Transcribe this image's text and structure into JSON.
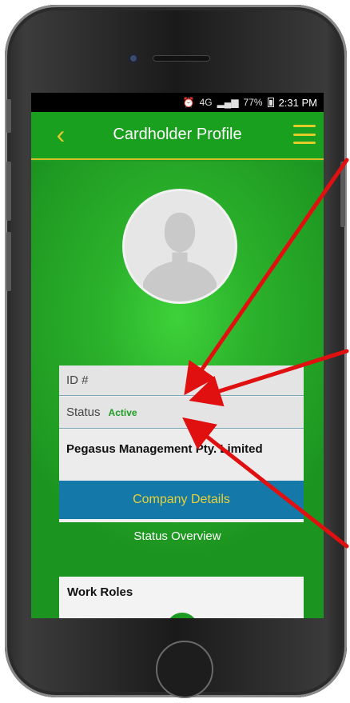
{
  "status_bar": {
    "network": "4G",
    "battery": "77%",
    "time": "2:31 PM"
  },
  "app_bar": {
    "back_icon": "chevron-left-icon",
    "title": "Cardholder Profile",
    "menu_icon": "hamburger-menu-icon"
  },
  "profile": {
    "avatar_icon": "person-silhouette-icon"
  },
  "details": {
    "id_label": "ID #",
    "status_label": "Status",
    "status_value": "Active",
    "company_name": "Pegasus Management Pty. Limited",
    "company_button_label": "Company Details"
  },
  "status_overview": {
    "heading": "Status Overview",
    "work_roles_label": "Work Roles"
  },
  "colors": {
    "accent_yellow": "#e3cc2a",
    "brand_green": "#1f9c24",
    "button_blue": "#1478a8",
    "annotation_red": "#e01010"
  }
}
